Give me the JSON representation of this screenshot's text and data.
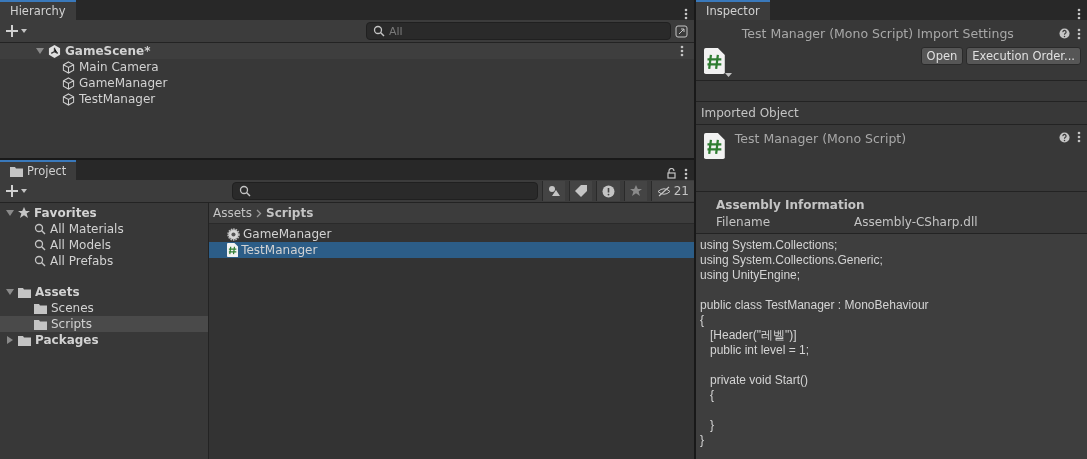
{
  "hierarchy": {
    "tab": "Hierarchy",
    "search_placeholder": "All",
    "scene": {
      "name": "GameScene*",
      "expanded": true,
      "children": [
        {
          "name": "Main Camera"
        },
        {
          "name": "GameManager"
        },
        {
          "name": "TestManager"
        }
      ]
    }
  },
  "project": {
    "tab": "Project",
    "hidden_count": "21",
    "favorites": {
      "name": "Favorites",
      "expanded": true,
      "children": [
        {
          "name": "All Materials"
        },
        {
          "name": "All Models"
        },
        {
          "name": "All Prefabs"
        }
      ]
    },
    "folders": [
      {
        "name": "Assets",
        "expanded": true,
        "children": [
          {
            "name": "Scenes",
            "selected": false
          },
          {
            "name": "Scripts",
            "selected": true
          }
        ]
      },
      {
        "name": "Packages",
        "expanded": false
      }
    ],
    "breadcrumb": [
      "Assets",
      "Scripts"
    ],
    "files": [
      {
        "name": "GameManager",
        "kind": "gear",
        "selected": false
      },
      {
        "name": "TestManager",
        "kind": "script",
        "selected": true
      }
    ]
  },
  "inspector": {
    "tab": "Inspector",
    "title": "Test Manager (Mono Script) Import Settings",
    "buttons": [
      "Open",
      "Execution Order..."
    ],
    "section": "Imported Object",
    "object_title": "Test Manager (Mono Script)",
    "assembly_heading": "Assembly Information",
    "filename_label": "Filename",
    "filename_value": "Assembly-CSharp.dll",
    "code_blocks": [
      [
        "using System.Collections;",
        "using System.Collections.Generic;",
        "using UnityEngine;"
      ],
      [
        "public class TestManager : MonoBehaviour",
        "{",
        "   [Header(\"레벨\")]",
        "   public int level = 1;"
      ],
      [
        "   private void Start()",
        "   {"
      ],
      [
        "   }",
        "}"
      ]
    ]
  }
}
